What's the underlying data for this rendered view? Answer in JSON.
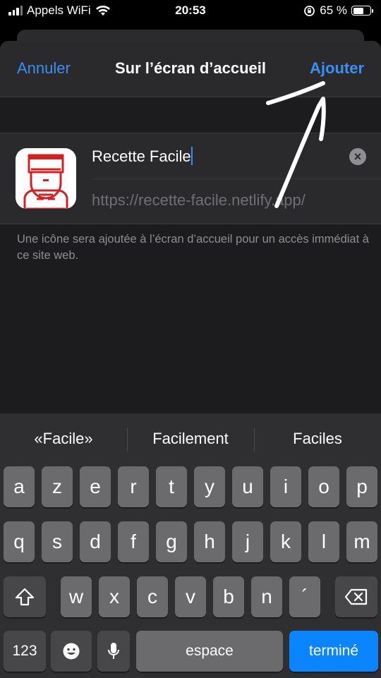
{
  "status_bar": {
    "carrier": "Appels WiFi",
    "time": "20:53",
    "battery": "65 %",
    "battery_level": 0.65
  },
  "nav": {
    "cancel": "Annuler",
    "title": "Sur l’écran d’accueil",
    "add": "Ajouter"
  },
  "shortcut": {
    "name_value": "Recette Facile",
    "url": "https://recette-facile.netlify.app/",
    "clear_icon": "clear-icon",
    "app_icon": "chef-icon"
  },
  "info_text": "Une icône sera ajoutée à l’écran d’accueil pour un accès immédiat à ce site web.",
  "keyboard": {
    "suggestions": [
      "«Facile»",
      "Facilement",
      "Faciles"
    ],
    "row1": [
      "a",
      "z",
      "e",
      "r",
      "t",
      "y",
      "u",
      "i",
      "o",
      "p"
    ],
    "row2": [
      "q",
      "s",
      "d",
      "f",
      "g",
      "h",
      "j",
      "k",
      "l",
      "m"
    ],
    "row3": [
      "w",
      "x",
      "c",
      "v",
      "b",
      "n",
      "´"
    ],
    "numbers_key": "123",
    "space_key": "espace",
    "done_key": "terminé"
  },
  "colors": {
    "accent": "#3a8ff7",
    "done_key": "#0a84ff",
    "sheet_bg": "#1c1c1e"
  }
}
